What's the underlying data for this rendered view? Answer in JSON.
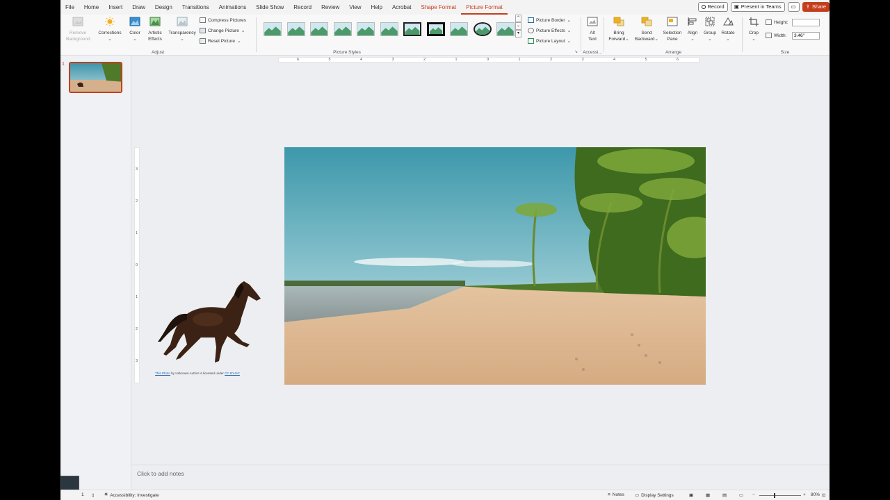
{
  "menu": {
    "tabs": [
      "File",
      "Home",
      "Insert",
      "Draw",
      "Design",
      "Transitions",
      "Animations",
      "Slide Show",
      "Record",
      "Review",
      "View",
      "Help",
      "Acrobat"
    ],
    "context_tabs": [
      "Shape Format",
      "Picture Format"
    ],
    "record_label": "Record",
    "present_label": "Present in Teams",
    "share_label": "Share"
  },
  "ribbon": {
    "adjust": {
      "remove_bg_l1": "Remove",
      "remove_bg_l2": "Background",
      "corrections": "Corrections",
      "color": "Color",
      "artistic_l1": "Artistic",
      "artistic_l2": "Effects",
      "transparency": "Transparency",
      "compress": "Compress Pictures",
      "change": "Change Picture",
      "reset": "Reset Picture",
      "label": "Adjust"
    },
    "styles": {
      "label": "Picture Styles",
      "border": "Picture Border",
      "effects": "Picture Effects",
      "layout": "Picture Layout"
    },
    "accessibility": {
      "alt_l1": "Alt",
      "alt_l2": "Text",
      "label": "Accessi..."
    },
    "arrange": {
      "bring_l1": "Bring",
      "bring_l2": "Forward",
      "send_l1": "Send",
      "send_l2": "Backward",
      "selection_l1": "Selection",
      "selection_l2": "Pane",
      "align": "Align",
      "group": "Group",
      "rotate": "Rotate",
      "label": "Arrange"
    },
    "size": {
      "crop": "Crop",
      "height_label": "Height:",
      "height_value": "",
      "width_label": "Width:",
      "width_value": "3.46\"",
      "label": "Size"
    }
  },
  "ruler": {
    "h_ticks": [
      "6",
      "5",
      "4",
      "3",
      "2",
      "1",
      "0",
      "1",
      "2",
      "3",
      "4",
      "5",
      "6"
    ],
    "v_ticks": [
      "3",
      "2",
      "1",
      "0",
      "1",
      "2",
      "3"
    ]
  },
  "thumbs": {
    "slide_number": "1"
  },
  "slide": {
    "attribution_link1": "This Photo",
    "attribution_mid": " by Unknown Author is licensed under ",
    "attribution_link2": "CC BY-NC"
  },
  "notes": {
    "placeholder": "Click to add notes"
  },
  "status": {
    "slide_label": "1",
    "accessibility": "Accessibility: Investigate",
    "notes": "Notes",
    "display": "Display Settings",
    "zoom": "80%"
  },
  "colors": {
    "accent": "#c43e1c",
    "sky_top": "#4a9bb0",
    "sand": "#d9b38c",
    "horse": "#3b2215"
  }
}
